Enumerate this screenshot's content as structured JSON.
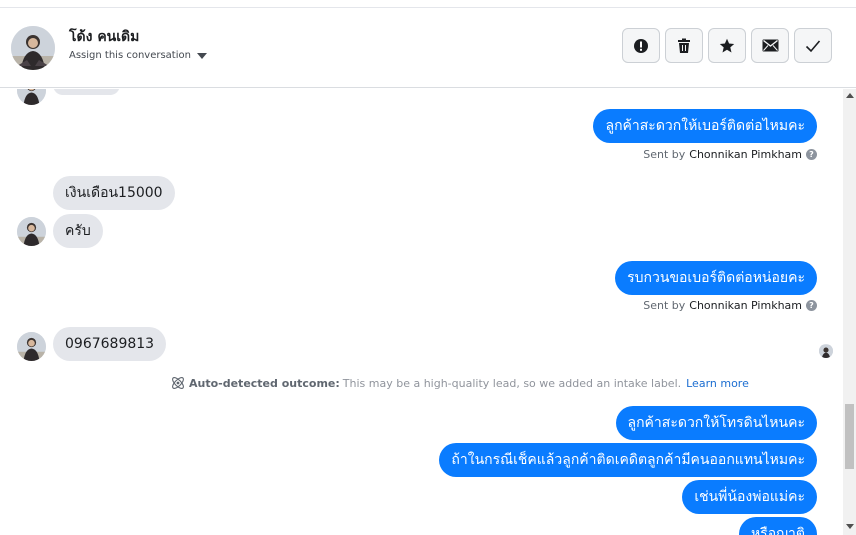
{
  "header": {
    "contact_name": "โด้ง คนเดิม",
    "assign_label": "Assign this conversation",
    "buttons": [
      {
        "icon": "alert-icon",
        "label": "Mark as spam"
      },
      {
        "icon": "trash-icon",
        "label": "Delete"
      },
      {
        "icon": "star-icon",
        "label": "Star"
      },
      {
        "icon": "envelope-icon",
        "label": "Mark as unread"
      },
      {
        "icon": "check-icon",
        "label": "Mark as done"
      }
    ]
  },
  "messages": {
    "out_1": "ลูกค้าสะดวกให้เบอร์ติดต่อไหมคะ",
    "sent_by_1": {
      "prefix": "Sent by",
      "name": "Chonnikan Pimkham"
    },
    "in_1": "เงินเดือน15000",
    "in_2": "ครับ",
    "out_2": "รบกวนขอเบอร์ติดต่อหน่อยคะ",
    "sent_by_2": {
      "prefix": "Sent by",
      "name": "Chonnikan Pimkham"
    },
    "in_3": "0967689813",
    "outcome": {
      "title": "Auto-detected outcome:",
      "text": "This may be a high-quality lead, so we added an intake label.",
      "link": "Learn more"
    },
    "out_3": "ลูกค้าสะดวกให้โทรดินไหนคะ",
    "out_4": "ถ้าในกรณีเช็คแล้วลูกค้าติดเคดิตลูกค้ามีคนออกแทนไหมคะ",
    "out_5": "เช่นพี่น้องพ่อแม่คะ",
    "out_6": "หรือญาติ"
  },
  "colors": {
    "outgoing_bubble": "#0a7cff",
    "incoming_bubble": "#e4e6eb",
    "link": "#1c6ed1"
  }
}
